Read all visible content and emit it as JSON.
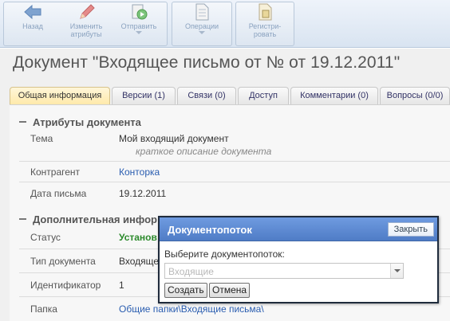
{
  "toolbar": {
    "back": "Назад",
    "edit_line1": "Изменить",
    "edit_line2": "атрибуты",
    "send": "Отправить",
    "operations": "Операции",
    "register_line1": "Регистри-",
    "register_line2": "ровать",
    "icons": {
      "back": "arrow-left-icon",
      "edit": "pencil-icon",
      "send": "send-document-icon",
      "operations": "document-icon",
      "register": "register-document-icon"
    }
  },
  "page": {
    "title": "Документ \"Входящее письмо от № от 19.12.2011\""
  },
  "tabs": [
    {
      "label": "Общая информация",
      "active": true
    },
    {
      "label": "Версии (1)",
      "active": false
    },
    {
      "label": "Связи (0)",
      "active": false
    },
    {
      "label": "Доступ",
      "active": false
    },
    {
      "label": "Комментарии (0)",
      "active": false
    },
    {
      "label": "Вопросы (0/0)",
      "active": false
    }
  ],
  "attributes": {
    "heading": "Атрибуты документа",
    "theme_label": "Тема",
    "theme_value": "Мой входящий документ",
    "theme_description": "краткое описание документа",
    "counterparty_label": "Контрагент",
    "counterparty_value": "Конторка",
    "letter_date_label": "Дата письма",
    "letter_date_value": "19.12.2011"
  },
  "additional": {
    "heading": "Дополнительная инфор",
    "status_label": "Статус",
    "status_value": "Установ",
    "doctype_label": "Тип документа",
    "doctype_value": "Входяще",
    "id_label": "Идентификатор",
    "id_value": "1",
    "folder_label": "Папка",
    "folder_value": "Общие папки\\Входящие письма\\"
  },
  "dialog": {
    "title": "Документопоток",
    "close": "Закрыть",
    "prompt": "Выберите документопоток:",
    "select_value": "Входящие",
    "create": "Создать",
    "cancel": "Отмена"
  },
  "colors": {
    "dialog_header": "#5a86d0",
    "link": "#2a5db0",
    "status_green": "#2c8a2c",
    "active_tab": "#ffe9a8"
  }
}
